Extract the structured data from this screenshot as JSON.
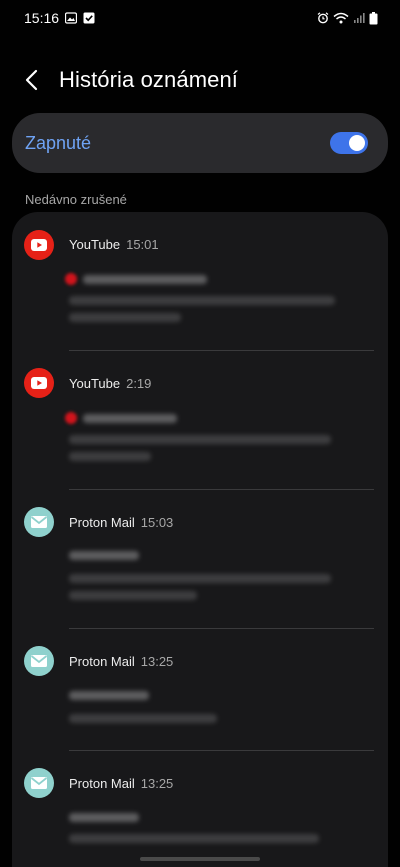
{
  "status_bar": {
    "time": "15:16",
    "left_icons": [
      "image-notification-icon",
      "checkbox-notification-icon"
    ],
    "right_icons": [
      "alarm-icon",
      "wifi-icon",
      "signal-icon",
      "battery-icon"
    ]
  },
  "header": {
    "back_icon": "chevron-left-icon",
    "title": "História oznámení"
  },
  "master_switch": {
    "label": "Zapnuté",
    "on": true,
    "accent_color": "#3e74ea"
  },
  "section_label": "Nedávno zrušené",
  "notifications": [
    {
      "app": "YouTube",
      "time": "15:01",
      "icon": "youtube-icon",
      "icon_color": "#e62117",
      "content_blurred": true
    },
    {
      "app": "YouTube",
      "time": "2:19",
      "icon": "youtube-icon",
      "icon_color": "#e62117",
      "content_blurred": true
    },
    {
      "app": "Proton Mail",
      "time": "15:03",
      "icon": "proton-mail-icon",
      "icon_color": "#8fd1cd",
      "content_blurred": true
    },
    {
      "app": "Proton Mail",
      "time": "13:25",
      "icon": "proton-mail-icon",
      "icon_color": "#8fd1cd",
      "content_blurred": true
    },
    {
      "app": "Proton Mail",
      "time": "13:25",
      "icon": "proton-mail-icon",
      "icon_color": "#8fd1cd",
      "content_blurred": true
    }
  ]
}
